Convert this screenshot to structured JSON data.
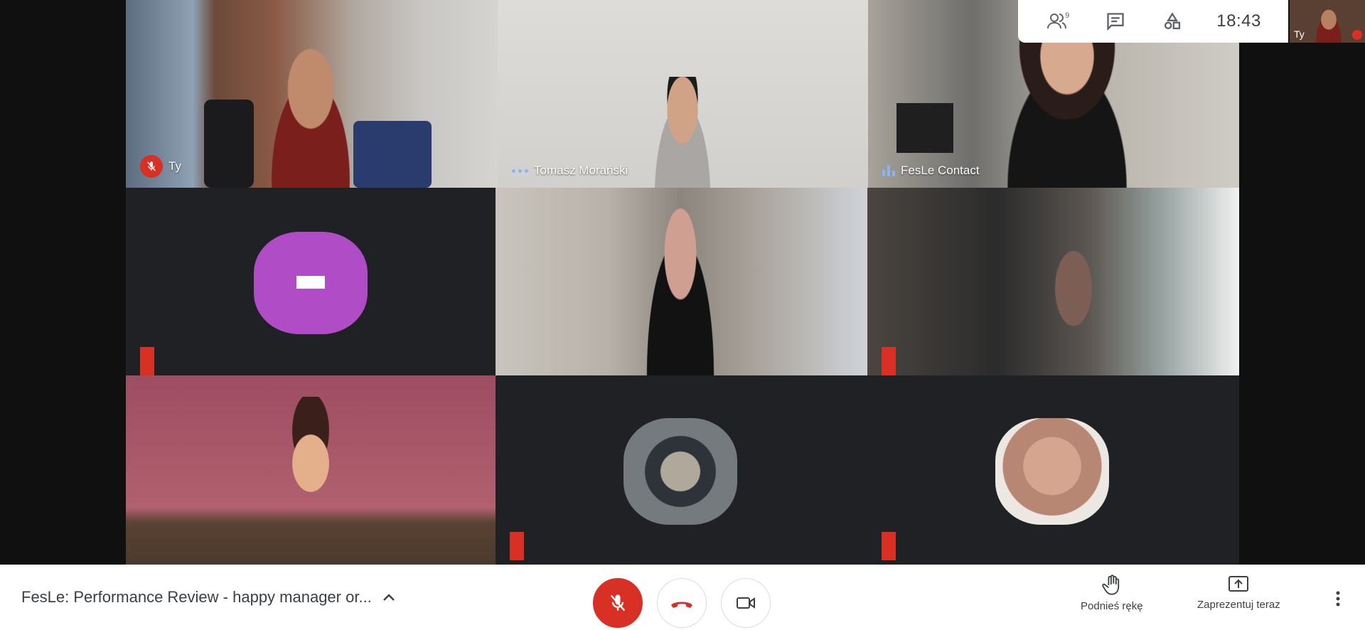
{
  "participants": {
    "self": {
      "name": "Ty"
    },
    "tomasz": {
      "name": "Tomasz Morański"
    },
    "fesle_contact": {
      "name": "FesLe Contact"
    }
  },
  "top_info": {
    "people_count": "9",
    "clock": "18:43",
    "self_thumb_label": "Ty"
  },
  "bottom": {
    "meeting_title": "FesLe: Performance Review - happy manager or...",
    "raise_hand_label": "Podnieś rękę",
    "present_label": "Zaprezentuj teraz"
  },
  "colors": {
    "accent_red": "#d93025",
    "speaking_blue": "#8ab4f8",
    "avatar_purple": "#b04dc6"
  }
}
